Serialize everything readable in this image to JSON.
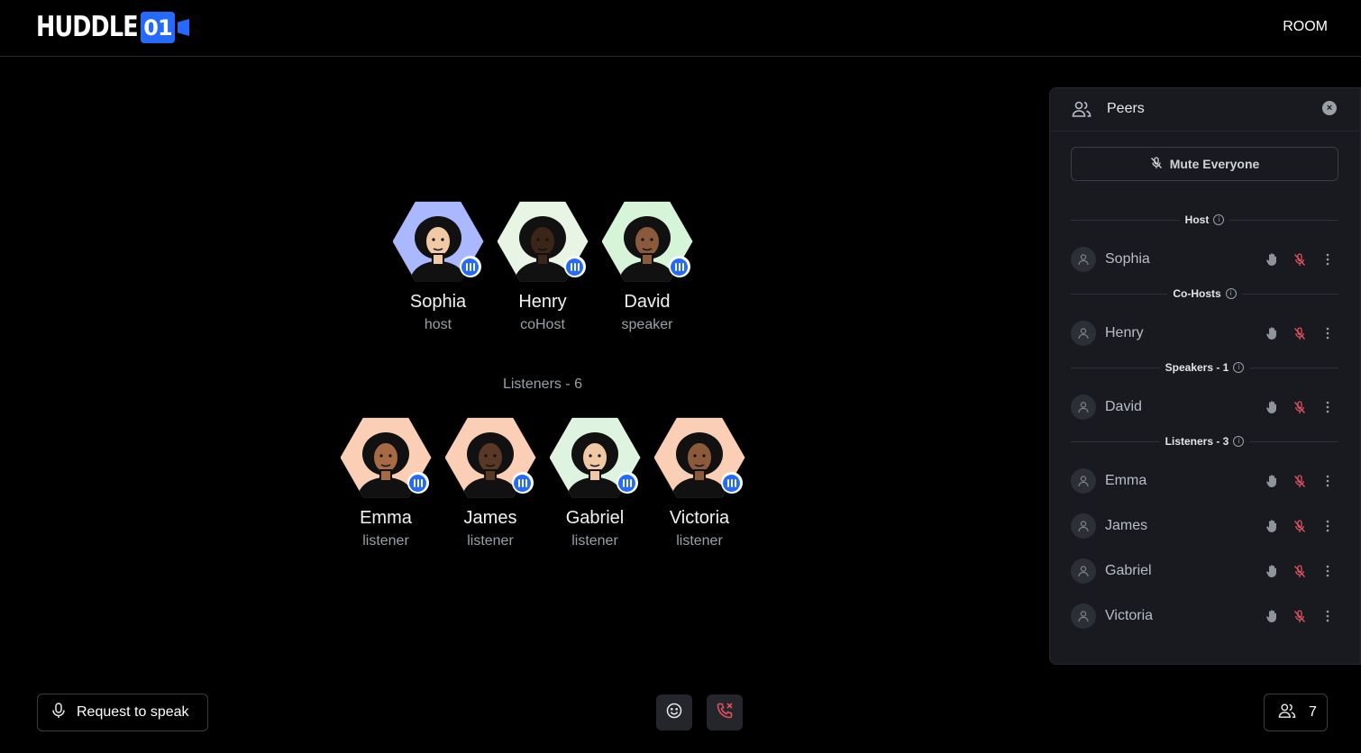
{
  "header": {
    "logo_text": "HUDDLE",
    "logo_badge": "01",
    "room_label": "ROOM"
  },
  "colors": {
    "accent": "#246bfd",
    "danger": "#e0525e",
    "panel_bg": "#181a1f"
  },
  "stage": {
    "speakers": [
      {
        "name": "Sophia",
        "role": "host",
        "bg": "#a9b8ff",
        "speaking": true
      },
      {
        "name": "Henry",
        "role": "coHost",
        "bg": "#e9f5e4",
        "speaking": true
      },
      {
        "name": "David",
        "role": "speaker",
        "bg": "#d6f5d8",
        "speaking": true
      }
    ],
    "listeners_title": "Listeners - 6",
    "listeners": [
      {
        "name": "Emma",
        "role": "listener",
        "bg": "#fbcfb5",
        "speaking": true
      },
      {
        "name": "James",
        "role": "listener",
        "bg": "#fbcfb5",
        "speaking": true
      },
      {
        "name": "Gabriel",
        "role": "listener",
        "bg": "#def3e0",
        "speaking": true
      },
      {
        "name": "Victoria",
        "role": "listener",
        "bg": "#fbcfb5",
        "speaking": true
      }
    ]
  },
  "panel": {
    "title": "Peers",
    "mute_all_label": "Mute Everyone",
    "sections": [
      {
        "label": "Host",
        "peers": [
          "Sophia"
        ]
      },
      {
        "label": "Co-Hosts",
        "peers": [
          "Henry"
        ]
      },
      {
        "label": "Speakers - 1",
        "peers": [
          "David"
        ]
      },
      {
        "label": "Listeners - 3",
        "peers": [
          "Emma",
          "James",
          "Gabriel",
          "Victoria"
        ]
      }
    ]
  },
  "footer": {
    "request_label": "Request to speak",
    "peer_count": "7",
    "icons": [
      "mic-icon",
      "emoji-icon",
      "end-call-icon",
      "users-icon"
    ]
  }
}
